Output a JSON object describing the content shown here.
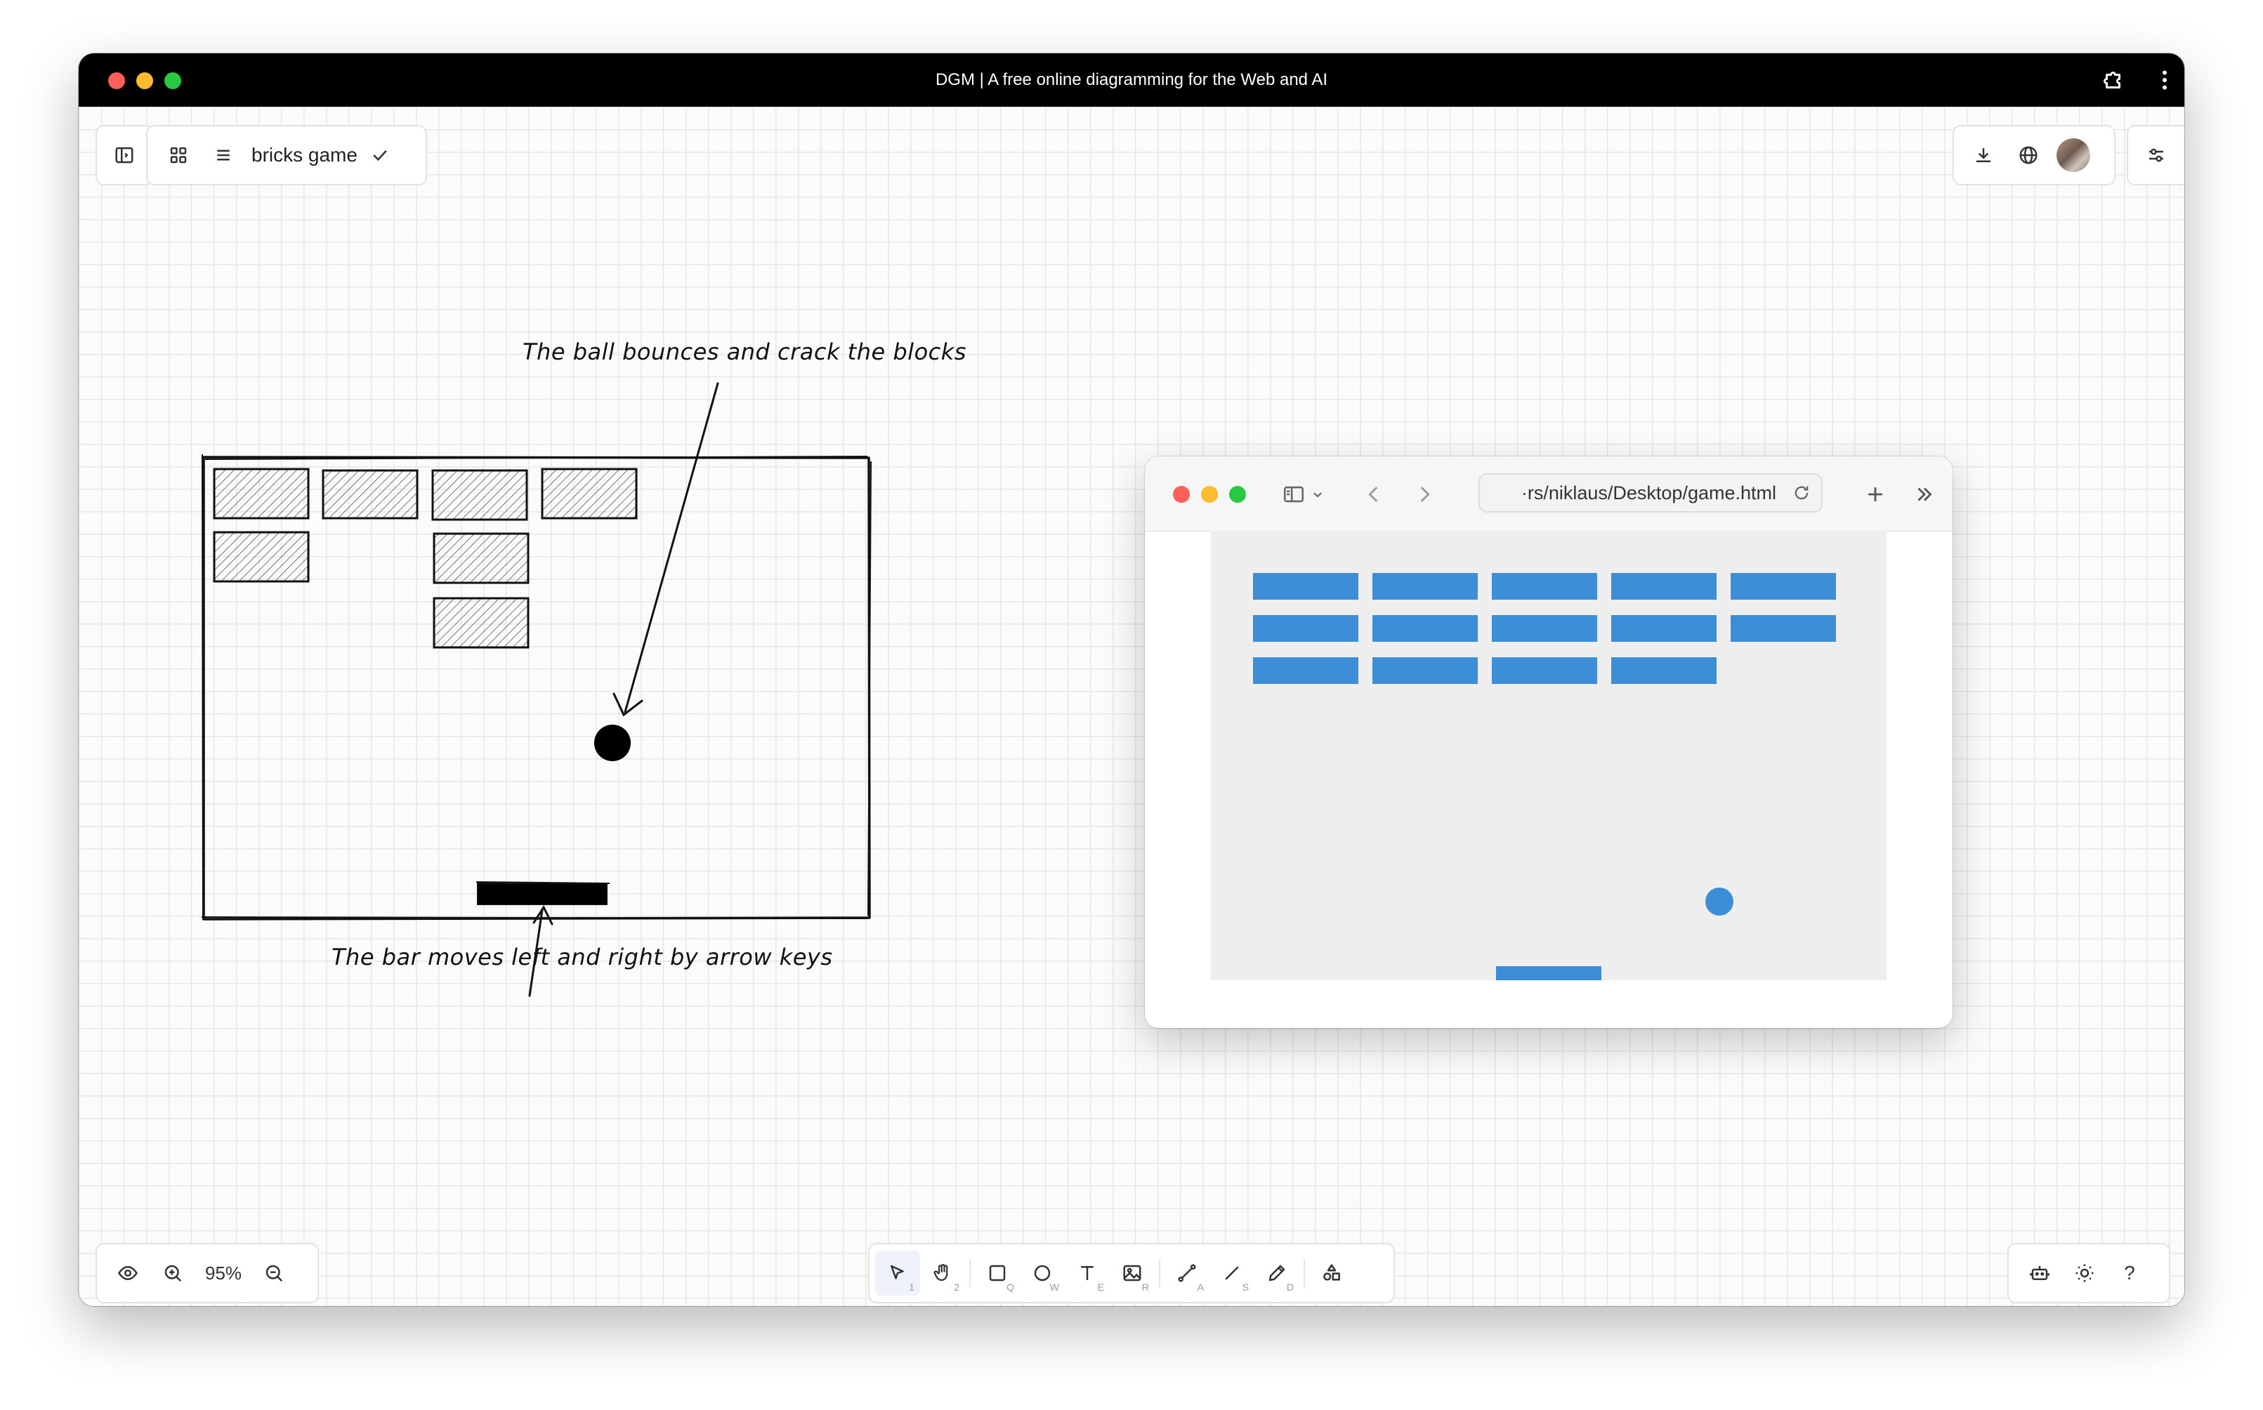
{
  "window": {
    "title": "DGM | A free online diagramming for the Web and AI"
  },
  "header": {
    "doc_title": "bricks game"
  },
  "sketch": {
    "ball_note": "The ball bounces and crack the blocks",
    "bar_note": "The bar moves left and right by arrow keys"
  },
  "browser": {
    "url": "·rs/niklaus/Desktop/game.html"
  },
  "bottom_left": {
    "zoom_level": "95%"
  },
  "toolbar": {
    "tools": [
      {
        "name": "select-tool",
        "icon": "pointer-icon",
        "shortcut": "1"
      },
      {
        "name": "hand-tool",
        "icon": "hand-icon",
        "shortcut": "2"
      },
      {
        "name": "rectangle-tool",
        "icon": "rectangle-icon",
        "shortcut": "Q"
      },
      {
        "name": "ellipse-tool",
        "icon": "ellipse-icon",
        "shortcut": "W"
      },
      {
        "name": "text-tool",
        "icon": "text-icon",
        "shortcut": "E"
      },
      {
        "name": "image-tool",
        "icon": "image-icon",
        "shortcut": "R"
      },
      {
        "name": "connector-tool",
        "icon": "connector-icon",
        "shortcut": "A"
      },
      {
        "name": "line-tool",
        "icon": "line-icon",
        "shortcut": "S"
      },
      {
        "name": "pencil-tool",
        "icon": "pencil-icon",
        "shortcut": "D"
      },
      {
        "name": "shapes-tool",
        "icon": "shapes-icon",
        "shortcut": ""
      }
    ]
  },
  "bottom_right": {
    "help_label": "?"
  },
  "colors": {
    "accent": "#3d8ed9",
    "titlebar": "#000000",
    "canvas": "#fbfbfb"
  }
}
